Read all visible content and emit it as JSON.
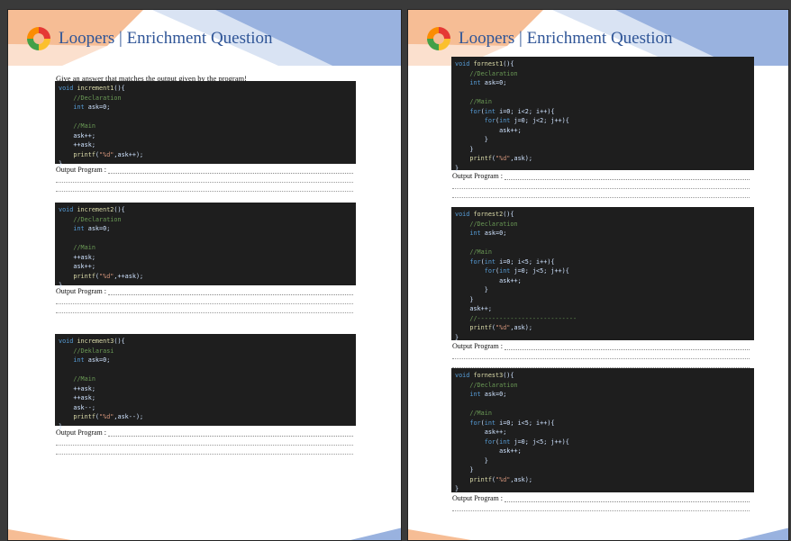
{
  "document": {
    "title": "Loopers | Enrichment Question",
    "instruction": "Give an answer that matches the output given by the program!",
    "output_label": "Output Program :",
    "colors": {
      "title": "#2f5597",
      "band_blue": "#8eaadb",
      "band_orange": "#f4b183",
      "code_bg": "#1e1e1e"
    }
  },
  "blocks": [
    {
      "id": "increment1",
      "lines": [
        [
          {
            "t": "kw",
            "v": "void "
          },
          {
            "t": "fn",
            "v": "increment1"
          },
          {
            "t": "tx",
            "v": "(){"
          }
        ],
        [
          {
            "t": "cm",
            "v": "    //Declaration"
          }
        ],
        [
          {
            "t": "kw",
            "v": "    int "
          },
          {
            "t": "tx",
            "v": "ask=0;"
          }
        ],
        [],
        [
          {
            "t": "cm",
            "v": "    //Main"
          }
        ],
        [
          {
            "t": "tx",
            "v": "    ask++;"
          }
        ],
        [
          {
            "t": "tx",
            "v": "    ++ask;"
          }
        ],
        [
          {
            "t": "fn",
            "v": "    printf"
          },
          {
            "t": "tx",
            "v": "("
          },
          {
            "t": "st",
            "v": "\"%d\""
          },
          {
            "t": "tx",
            "v": ",ask++);"
          }
        ],
        [
          {
            "t": "tx",
            "v": "}"
          }
        ]
      ]
    },
    {
      "id": "increment2",
      "lines": [
        [
          {
            "t": "kw",
            "v": "void "
          },
          {
            "t": "fn",
            "v": "increment2"
          },
          {
            "t": "tx",
            "v": "(){"
          }
        ],
        [
          {
            "t": "cm",
            "v": "    //Declaration"
          }
        ],
        [
          {
            "t": "kw",
            "v": "    int "
          },
          {
            "t": "tx",
            "v": "ask=0;"
          }
        ],
        [],
        [
          {
            "t": "cm",
            "v": "    //Main"
          }
        ],
        [
          {
            "t": "tx",
            "v": "    ++ask;"
          }
        ],
        [
          {
            "t": "tx",
            "v": "    ask++;"
          }
        ],
        [
          {
            "t": "fn",
            "v": "    printf"
          },
          {
            "t": "tx",
            "v": "("
          },
          {
            "t": "st",
            "v": "\"%d\""
          },
          {
            "t": "tx",
            "v": ",++ask);"
          }
        ],
        [
          {
            "t": "tx",
            "v": "}"
          }
        ]
      ]
    },
    {
      "id": "increment3",
      "lines": [
        [
          {
            "t": "kw",
            "v": "void "
          },
          {
            "t": "fn",
            "v": "increment3"
          },
          {
            "t": "tx",
            "v": "(){"
          }
        ],
        [
          {
            "t": "cm",
            "v": "    //Deklarasi"
          }
        ],
        [
          {
            "t": "kw",
            "v": "    int "
          },
          {
            "t": "tx",
            "v": "ask=0;"
          }
        ],
        [],
        [
          {
            "t": "cm",
            "v": "    //Main"
          }
        ],
        [
          {
            "t": "tx",
            "v": "    ++ask;"
          }
        ],
        [
          {
            "t": "tx",
            "v": "    ++ask;"
          }
        ],
        [
          {
            "t": "tx",
            "v": "    ask--;"
          }
        ],
        [
          {
            "t": "fn",
            "v": "    printf"
          },
          {
            "t": "tx",
            "v": "("
          },
          {
            "t": "st",
            "v": "\"%d\""
          },
          {
            "t": "tx",
            "v": ",ask--);"
          }
        ],
        [
          {
            "t": "tx",
            "v": "}"
          }
        ]
      ]
    },
    {
      "id": "fornest1",
      "lines": [
        [
          {
            "t": "kw",
            "v": "void "
          },
          {
            "t": "fn",
            "v": "fornest1"
          },
          {
            "t": "tx",
            "v": "(){"
          }
        ],
        [
          {
            "t": "cm",
            "v": "    //Declaration"
          }
        ],
        [
          {
            "t": "kw",
            "v": "    int "
          },
          {
            "t": "tx",
            "v": "ask=0;"
          }
        ],
        [],
        [
          {
            "t": "cm",
            "v": "    //Main"
          }
        ],
        [
          {
            "t": "kw",
            "v": "    for"
          },
          {
            "t": "tx",
            "v": "("
          },
          {
            "t": "kw",
            "v": "int "
          },
          {
            "t": "tx",
            "v": "i=0; i<2; i++){"
          }
        ],
        [
          {
            "t": "kw",
            "v": "        for"
          },
          {
            "t": "tx",
            "v": "("
          },
          {
            "t": "kw",
            "v": "int "
          },
          {
            "t": "tx",
            "v": "j=0; j<2; j++){"
          }
        ],
        [
          {
            "t": "tx",
            "v": "            ask++;"
          }
        ],
        [
          {
            "t": "tx",
            "v": "        }"
          }
        ],
        [
          {
            "t": "tx",
            "v": "    }"
          }
        ],
        [
          {
            "t": "fn",
            "v": "    printf"
          },
          {
            "t": "tx",
            "v": "("
          },
          {
            "t": "st",
            "v": "\"%d\""
          },
          {
            "t": "tx",
            "v": ",ask);"
          }
        ],
        [
          {
            "t": "tx",
            "v": "}"
          }
        ]
      ]
    },
    {
      "id": "fornest2",
      "lines": [
        [
          {
            "t": "kw",
            "v": "void "
          },
          {
            "t": "fn",
            "v": "fornest2"
          },
          {
            "t": "tx",
            "v": "(){"
          }
        ],
        [
          {
            "t": "cm",
            "v": "    //Declaration"
          }
        ],
        [
          {
            "t": "kw",
            "v": "    int "
          },
          {
            "t": "tx",
            "v": "ask=0;"
          }
        ],
        [],
        [
          {
            "t": "cm",
            "v": "    //Main"
          }
        ],
        [
          {
            "t": "kw",
            "v": "    for"
          },
          {
            "t": "tx",
            "v": "("
          },
          {
            "t": "kw",
            "v": "int "
          },
          {
            "t": "tx",
            "v": "i=0; i<5; i++){"
          }
        ],
        [
          {
            "t": "kw",
            "v": "        for"
          },
          {
            "t": "tx",
            "v": "("
          },
          {
            "t": "kw",
            "v": "int "
          },
          {
            "t": "tx",
            "v": "j=0; j<5; j++){"
          }
        ],
        [
          {
            "t": "tx",
            "v": "            ask++;"
          }
        ],
        [
          {
            "t": "tx",
            "v": "        }"
          }
        ],
        [
          {
            "t": "tx",
            "v": "    }"
          }
        ],
        [
          {
            "t": "tx",
            "v": "    ask++;"
          }
        ],
        [
          {
            "t": "cm",
            "v": "    //---------------------------"
          }
        ],
        [
          {
            "t": "fn",
            "v": "    printf"
          },
          {
            "t": "tx",
            "v": "("
          },
          {
            "t": "st",
            "v": "\"%d\""
          },
          {
            "t": "tx",
            "v": ",ask);"
          }
        ],
        [
          {
            "t": "tx",
            "v": "}"
          }
        ]
      ]
    },
    {
      "id": "fornest3",
      "lines": [
        [
          {
            "t": "kw",
            "v": "void "
          },
          {
            "t": "fn",
            "v": "fornest3"
          },
          {
            "t": "tx",
            "v": "(){"
          }
        ],
        [
          {
            "t": "cm",
            "v": "    //Declaration"
          }
        ],
        [
          {
            "t": "kw",
            "v": "    int "
          },
          {
            "t": "tx",
            "v": "ask=0;"
          }
        ],
        [],
        [
          {
            "t": "cm",
            "v": "    //Main"
          }
        ],
        [
          {
            "t": "kw",
            "v": "    for"
          },
          {
            "t": "tx",
            "v": "("
          },
          {
            "t": "kw",
            "v": "int "
          },
          {
            "t": "tx",
            "v": "i=0; i<5; i++){"
          }
        ],
        [
          {
            "t": "tx",
            "v": "        ask++;"
          }
        ],
        [
          {
            "t": "kw",
            "v": "        for"
          },
          {
            "t": "tx",
            "v": "("
          },
          {
            "t": "kw",
            "v": "int "
          },
          {
            "t": "tx",
            "v": "j=0; j<5; j++){"
          }
        ],
        [
          {
            "t": "tx",
            "v": "            ask++;"
          }
        ],
        [
          {
            "t": "tx",
            "v": "        }"
          }
        ],
        [
          {
            "t": "tx",
            "v": "    }"
          }
        ],
        [
          {
            "t": "fn",
            "v": "    printf"
          },
          {
            "t": "tx",
            "v": "("
          },
          {
            "t": "st",
            "v": "\"%d\""
          },
          {
            "t": "tx",
            "v": ",ask);"
          }
        ],
        [
          {
            "t": "tx",
            "v": "}"
          }
        ]
      ]
    }
  ]
}
